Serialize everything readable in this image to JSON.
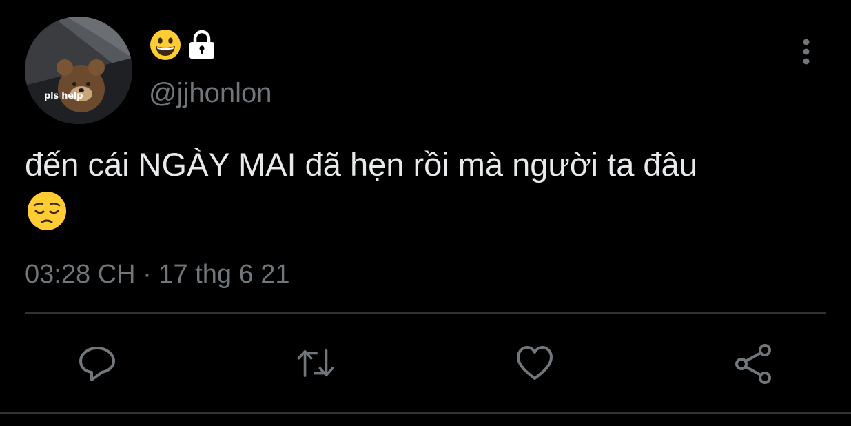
{
  "author": {
    "avatar_caption": "pls help",
    "display_name_icons": [
      "grinning-face-icon",
      "lock-icon"
    ],
    "handle": "@jjhonlon"
  },
  "tweet": {
    "text": "đến cái NGÀY MAI đã hẹn rồi mà người ta đâu",
    "trailing_emoji": "pensive-face-icon",
    "timestamp": "03:28 CH · 17 thg 6 21"
  },
  "actions": [
    "reply-icon",
    "retweet-icon",
    "like-icon",
    "share-icon"
  ],
  "colors": {
    "background": "#000000",
    "text": "#e7e9ea",
    "muted": "#71767b",
    "divider": "#2f3336",
    "emoji_yellow": "#ffcc33"
  }
}
